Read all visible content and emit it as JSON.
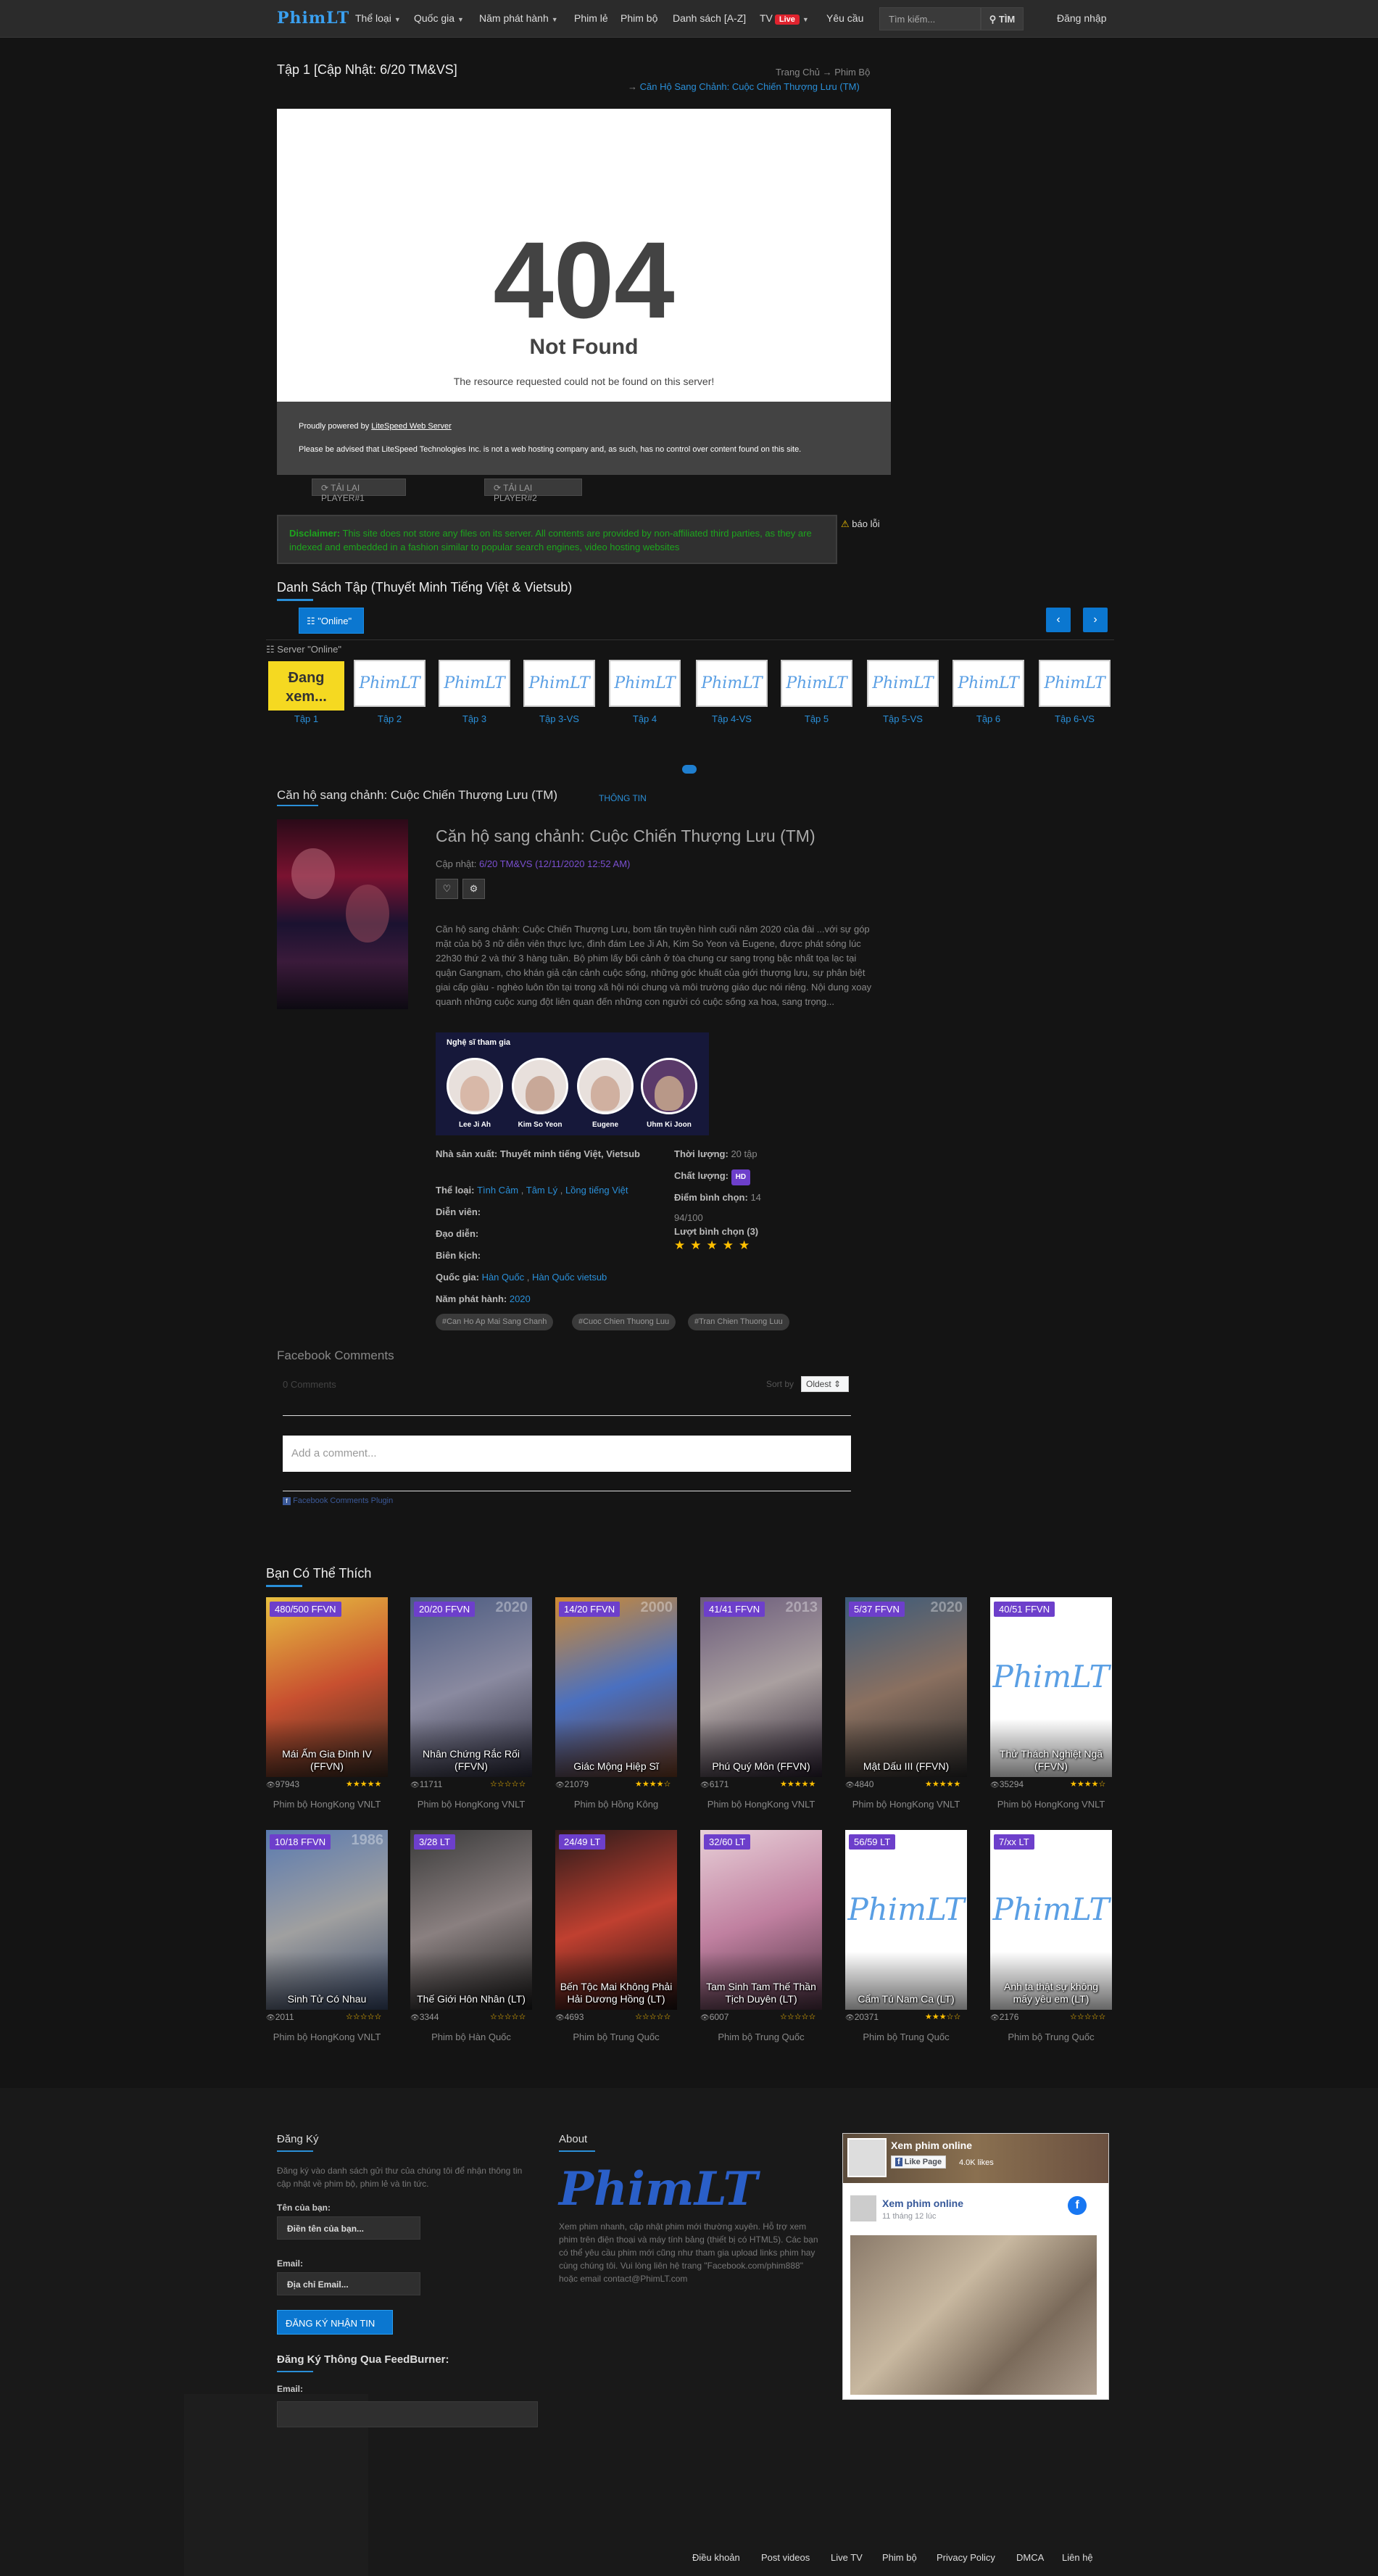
{
  "nav": {
    "logo": "PhimLT",
    "items": [
      "Thể loại",
      "Quốc gia",
      "Năm phát hành",
      "Phim lẻ",
      "Phim bộ",
      "Danh sách [A-Z]",
      "TV",
      "Yêu cầu"
    ],
    "live_badge": "Live",
    "search_placeholder": "Tìm kiếm...",
    "search_button": "TÌM",
    "login": "Đăng nhập"
  },
  "episode": {
    "title": "Tập 1 [Cập Nhật: 6/20 TM&VS]",
    "breadcrumb_home": "Trang Chủ",
    "breadcrumb_cat": "Phim Bộ",
    "breadcrumb_movie": "Căn Hộ Sang Chảnh: Cuộc Chiến Thượng Lưu (TM)"
  },
  "player": {
    "code": "404",
    "status": "Not Found",
    "message": "The resource requested could not be found on this server!",
    "powered_prefix": "Proudly powered by ",
    "powered_link": "LiteSpeed Web Server",
    "advise": "Please be advised that LiteSpeed Technologies Inc. is not a web hosting company and, as such, has no control over content found on this site.",
    "reload1": "TẢI LẠI PLAYER#1",
    "reload2": "TẢI LẠI PLAYER#2"
  },
  "disclaimer": {
    "label": "Disclaimer:",
    "text": " This site does not store any files on its server. All contents are provided by non-affiliated third parties, as they are indexed and embedded in a fashion similar to popular search engines, video hosting websites",
    "report": "báo lỗi"
  },
  "episodes": {
    "title": "Danh Sách Tập (Thuyết Minh Tiếng Việt & Vietsub)",
    "online_button": "\"Online\"",
    "server_label": "Server \"Online\"",
    "current_label": "Đang xem...",
    "logo_text": "PhimLT",
    "labels": [
      "Tập 1",
      "Tập 2",
      "Tập 3",
      "Tập 3-VS",
      "Tập 4",
      "Tập 4-VS",
      "Tập 5",
      "Tập 5-VS",
      "Tập 6",
      "Tập 6-VS"
    ]
  },
  "info": {
    "section_title": "Căn hộ sang chảnh: Cuộc Chiến Thượng Lưu (TM)",
    "tab": "THÔNG TIN",
    "title": "Căn hộ sang chảnh: Cuộc Chiến Thượng Lưu (TM)",
    "updated_label": "Cập nhật: ",
    "updated_value": "6/20 TM&VS (12/11/2020 12:52 AM)",
    "description": "Căn hộ sang chảnh: Cuộc Chiến Thượng Lưu, bom tấn truyền hình cuối năm 2020 của đài ...với sự góp mặt của bộ 3 nữ diễn viên thực lực, đình đám Lee Ji Ah, Kim So Yeon và Eugene, được phát sóng lúc 22h30 thứ 2 và thứ 3 hàng tuần. Bộ phim lấy bối cảnh ở tòa chung cư sang trọng bậc nhất tọa lạc tại quận Gangnam, cho khán giả cận cảnh cuộc sống, những góc khuất của giới thượng lưu, sự phân biệt giai cấp giàu - nghèo luôn tồn tại trong xã hội nói chung và môi trường giáo dục nói riêng. Nội dung xoay quanh những cuộc xung đột liên quan đến những con người có cuộc sống xa hoa, sang trọng...",
    "cast_title": "Nghệ sĩ tham gia",
    "cast": [
      "Lee Ji Ah",
      "Kim So Yeon",
      "Eugene",
      "Uhm Ki Joon"
    ],
    "producer_label": "Nhà sản xuất: ",
    "producer_value": "Thuyết minh tiếng Việt, Vietsub",
    "genre_label": "Thể loại: ",
    "genres": [
      "Tình Cảm",
      "Tâm Lý",
      "Lồng tiếng Việt"
    ],
    "actor_label": "Diễn viên:",
    "director_label": "Đạo diễn:",
    "writer_label": "Biên kịch:",
    "country_label": "Quốc gia: ",
    "countries": [
      "Hàn Quốc",
      "Hàn Quốc vietsub"
    ],
    "year_label": "Năm phát hành: ",
    "year_value": "2020",
    "duration_label": "Thời lượng: ",
    "duration_value": "20 tập",
    "quality_label": "Chất lượng: ",
    "quality_value": "HD",
    "score_label": "Điểm bình chọn: ",
    "score_value": "14",
    "score_total": "94/100",
    "votes_label": "Lượt bình chọn (3)",
    "rating": 5,
    "tags": [
      "#Can Ho Ap Mai Sang Chanh",
      "#Cuoc Chien Thuong Luu",
      "#Tran Chien Thuong Luu"
    ]
  },
  "comments": {
    "title": "Facebook Comments",
    "count": "0 Comments",
    "sort_label": "Sort by",
    "sort_value": "Oldest",
    "placeholder": "Add a comment...",
    "plugin": "Facebook Comments Plugin"
  },
  "recommend": {
    "title": "Bạn Có Thể Thích",
    "items": [
      {
        "badge": "480/500 FFVN",
        "year": "",
        "title": "Mái Ấm Gia Đình IV (FFVN)",
        "views": "97943",
        "rating": 5,
        "cat": "Phim bộ HongKong VNLT",
        "colors": [
          "#e8c040",
          "#c85030",
          "#3a2a20"
        ]
      },
      {
        "badge": "20/20 FFVN",
        "year": "2020",
        "title": "Nhân Chứng Rắc Rối (FFVN)",
        "views": "11711",
        "rating": 0,
        "cat": "Phim bộ HongKong VNLT",
        "colors": [
          "#4a5a80",
          "#8a8aa0",
          "#2a2a3a"
        ]
      },
      {
        "badge": "14/20 FFVN",
        "year": "2000",
        "title": "Giác Mộng Hiệp Sĩ",
        "views": "21079",
        "rating": 4,
        "cat": "Phim bộ Hồng Kông",
        "colors": [
          "#d08a30",
          "#4a70c0",
          "#6a3a20"
        ]
      },
      {
        "badge": "41/41 FFVN",
        "year": "2013",
        "title": "Phú Quý Môn (FFVN)",
        "views": "6171",
        "rating": 5,
        "cat": "Phim bộ HongKong VNLT",
        "colors": [
          "#6a5a7a",
          "#aaa0a0",
          "#2a2030"
        ]
      },
      {
        "badge": "5/37 FFVN",
        "year": "2020",
        "title": "Mật Dấu III (FFVN)",
        "views": "4840",
        "rating": 5,
        "cat": "Phim bộ HongKong VNLT",
        "colors": [
          "#3a5a7a",
          "#8a7060",
          "#2a2a2a"
        ]
      },
      {
        "badge": "40/51 FFVN",
        "year": "",
        "title": "Thử Thách Nghiệt Ngã (FFVN)",
        "views": "35294",
        "rating": 4,
        "cat": "Phim bộ HongKong VNLT",
        "logo": true
      },
      {
        "badge": "10/18 FFVN",
        "year": "1986",
        "title": "Sinh Tử Có Nhau",
        "views": "2011",
        "rating": 0,
        "cat": "Phim bộ HongKong VNLT",
        "colors": [
          "#5a7ab0",
          "#a0a0a0",
          "#3a4a6a"
        ]
      },
      {
        "badge": "3/28 LT",
        "year": "",
        "title": "Thế Giới Hôn Nhân (LT)",
        "views": "3344",
        "rating": 0,
        "cat": "Phim bộ Hàn Quốc",
        "colors": [
          "#3a3a3a",
          "#8a8080",
          "#1a1a1a"
        ]
      },
      {
        "badge": "24/49 LT",
        "year": "",
        "title": "Bến Tộc Mai Không Phải Hải Dương Hồng (LT)",
        "views": "4693",
        "rating": 0,
        "cat": "Phim bộ Trung Quốc",
        "colors": [
          "#2a1a1a",
          "#c04030",
          "#1a1010"
        ]
      },
      {
        "badge": "32/60 LT",
        "year": "",
        "title": "Tam Sinh Tam Thế Thần Tịch Duyên (LT)",
        "views": "6007",
        "rating": 0,
        "cat": "Phim bộ Trung Quốc",
        "colors": [
          "#e8d0d8",
          "#c080a0",
          "#4a3040"
        ]
      },
      {
        "badge": "56/59 LT",
        "year": "",
        "title": "Cẩm Tú Nam Ca (LT)",
        "views": "20371",
        "rating": 3,
        "cat": "Phim bộ Trung Quốc",
        "logo": true
      },
      {
        "badge": "7/xx LT",
        "year": "",
        "title": "Anh ta thật sự không mấy yêu em (LT)",
        "views": "2176",
        "rating": 0,
        "cat": "Phim bộ Trung Quốc",
        "logo": true
      }
    ]
  },
  "footer": {
    "signup_title": "Đăng Ký",
    "signup_text": "Đăng ký vào danh sách gửi thư của chúng tôi để nhận thông tin cập nhật về phim bộ, phim lẻ và tin tức.",
    "name_label": "Tên của bạn:",
    "name_placeholder": "Điền tên của bạn...",
    "email_label": "Email:",
    "email_placeholder": "Địa chỉ Email...",
    "submit": "ĐĂNG KÝ NHẬN TIN",
    "feedburner_title": "Đăng Ký Thông Qua FeedBurner:",
    "fb_email_label": "Email:",
    "about_title": "About",
    "about_logo": "PhimLT",
    "about_text": "Xem phim nhanh, cập nhật phim mới thường xuyên. Hỗ trợ xem phim trên điện thoại và máy tính bảng (thiết bị có HTML5). Các bạn có thể yêu cầu phim mới cũng như tham gia upload links phim hay cùng chúng tôi. Vui lòng liên hệ trang \"Facebook.com/phim888\" hoặc email contact@PhimLT.com",
    "fb_page": "Xem phim online",
    "fb_like": "Like Page",
    "fb_likes": "4.0K likes",
    "fb_post_name": "Xem phim online",
    "fb_post_time": "11 tháng 12 lúc",
    "links": [
      "Điều khoản",
      "Post videos",
      "Live TV",
      "Phim bộ",
      "Privacy Policy",
      "DMCA",
      "Liên hệ"
    ]
  }
}
